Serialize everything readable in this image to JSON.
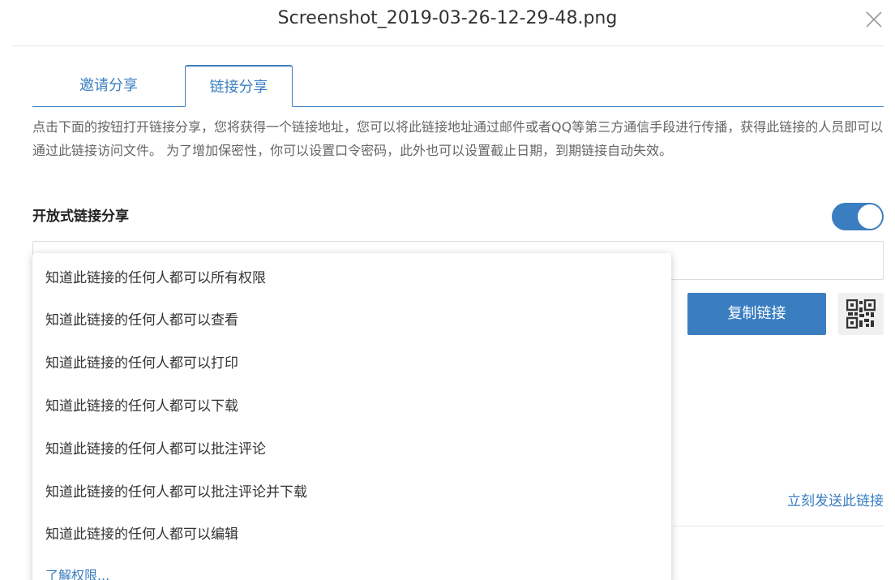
{
  "header": {
    "title": "Screenshot_2019-03-26-12-29-48.png",
    "close_icon": "close-icon"
  },
  "tabs": [
    {
      "label": "邀请分享",
      "active": false
    },
    {
      "label": "链接分享",
      "active": true
    }
  ],
  "description": "点击下面的按钮打开链接分享，您将获得一个链接地址，您可以将此链接地址通过邮件或者QQ等第三方通信手段进行传播，获得此链接的人员即可以通过此链接访问文件。 为了增加保密性，你可以设置口令密码，此外也可以设置截止日期，到期链接自动失效。",
  "open_link": {
    "label": "开放式链接分享",
    "enabled": true
  },
  "permission_dropdown": {
    "options": [
      "知道此链接的任何人都可以所有权限",
      "知道此链接的任何人都可以查看",
      "知道此链接的任何人都可以打印",
      "知道此链接的任何人都可以下载",
      "知道此链接的任何人都可以批注评论",
      "知道此链接的任何人都可以批注评论并下载",
      "知道此链接的任何人都可以编辑"
    ],
    "footer_link": "了解权限..."
  },
  "actions": {
    "copy_link": "复制链接",
    "qr_icon": "qr-code-icon",
    "send_link": "立刻发送此链接"
  },
  "colors": {
    "accent": "#3a7ec1",
    "text": "#333333",
    "muted_text": "#666666",
    "border": "#dcdcdc"
  }
}
